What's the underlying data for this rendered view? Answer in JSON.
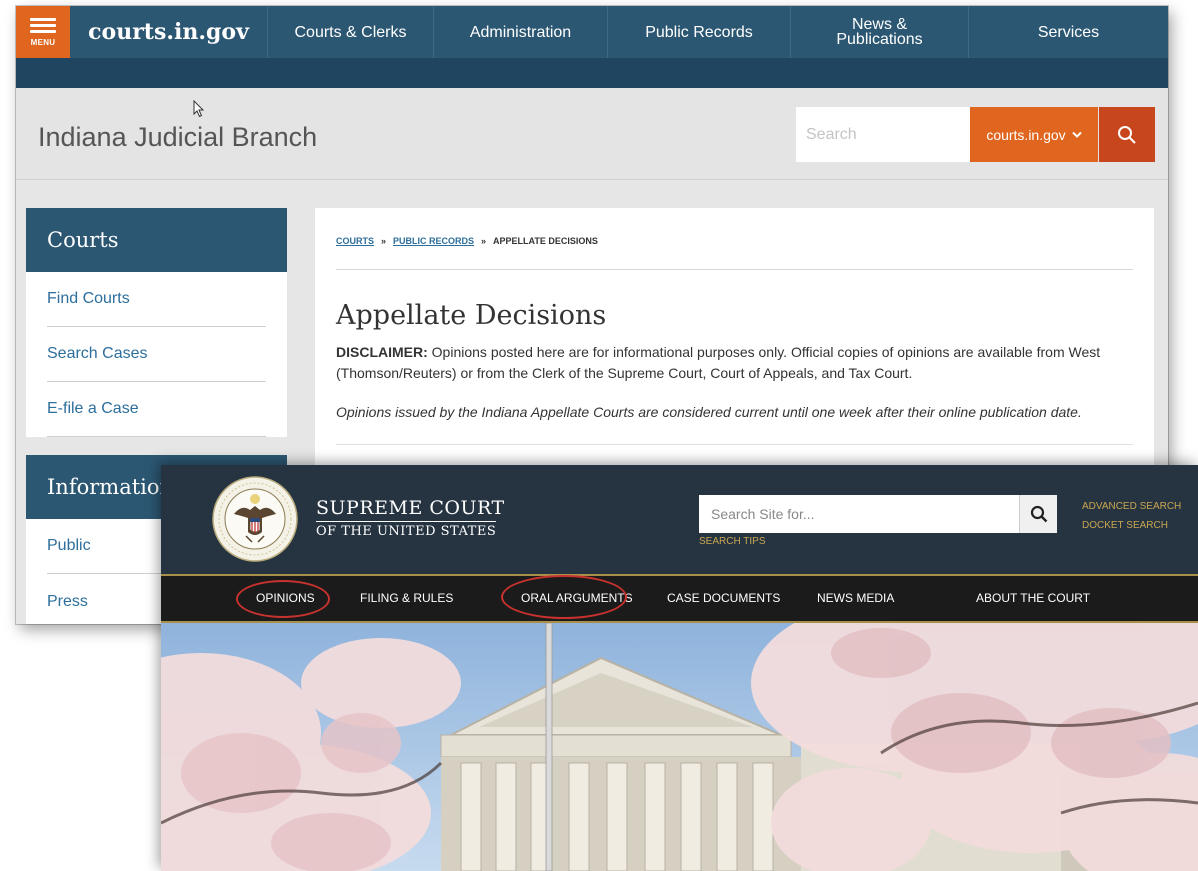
{
  "indiana": {
    "menu_label": "MENU",
    "logo": "courts.in.gov",
    "nav": [
      {
        "label": "Courts & Clerks"
      },
      {
        "label": "Administration"
      },
      {
        "label": "Public Records"
      },
      {
        "label": "News &\nPublications"
      },
      {
        "label": "Services"
      }
    ],
    "site_title": "Indiana Judicial Branch",
    "search_placeholder": "Search",
    "search_scope": "courts.in.gov",
    "sidebar": {
      "courts_heading": "Courts",
      "courts_links": [
        "Find Courts",
        "Search Cases",
        "E-file a Case"
      ],
      "info_heading": "Information",
      "info_links": [
        "Public",
        "Press"
      ]
    },
    "breadcrumb": {
      "items": [
        "COURTS",
        "PUBLIC RECORDS",
        "APPELLATE DECISIONS"
      ],
      "separator": "»"
    },
    "page_title": "Appellate Decisions",
    "disclaimer_label": "DISCLAIMER:",
    "disclaimer_text": " Opinions posted here are for informational purposes only. Official copies of opinions are available from West (Thomson/Reuters) or from the Clerk of the Supreme Court, Court of Appeals, and Tax Court.",
    "note": "Opinions issued by the Indiana Appellate Courts are considered current until one week after their online publication date."
  },
  "scotus": {
    "title_line1": "SUPREME COURT",
    "title_line2": "OF THE UNITED STATES",
    "search_placeholder": "Search Site for...",
    "search_tips": "SEARCH TIPS",
    "advanced_search": "ADVANCED SEARCH",
    "docket_search": "DOCKET SEARCH",
    "nav": [
      "OPINIONS",
      "FILING & RULES",
      "ORAL ARGUMENTS",
      "CASE DOCUMENTS",
      "NEWS MEDIA",
      "ABOUT THE COURT"
    ],
    "circled_items": [
      "OPINIONS",
      "ORAL ARGUMENTS"
    ]
  },
  "colors": {
    "indiana_navy": "#2c5773",
    "indiana_orange": "#e0651f",
    "scotus_dark": "#263442",
    "scotus_gold": "#c9a650",
    "highlight_circle": "#c8322e"
  },
  "icons": [
    "hamburger-menu-icon",
    "chevron-down-icon",
    "search-icon",
    "mouse-cursor-icon",
    "court-seal-icon"
  ]
}
